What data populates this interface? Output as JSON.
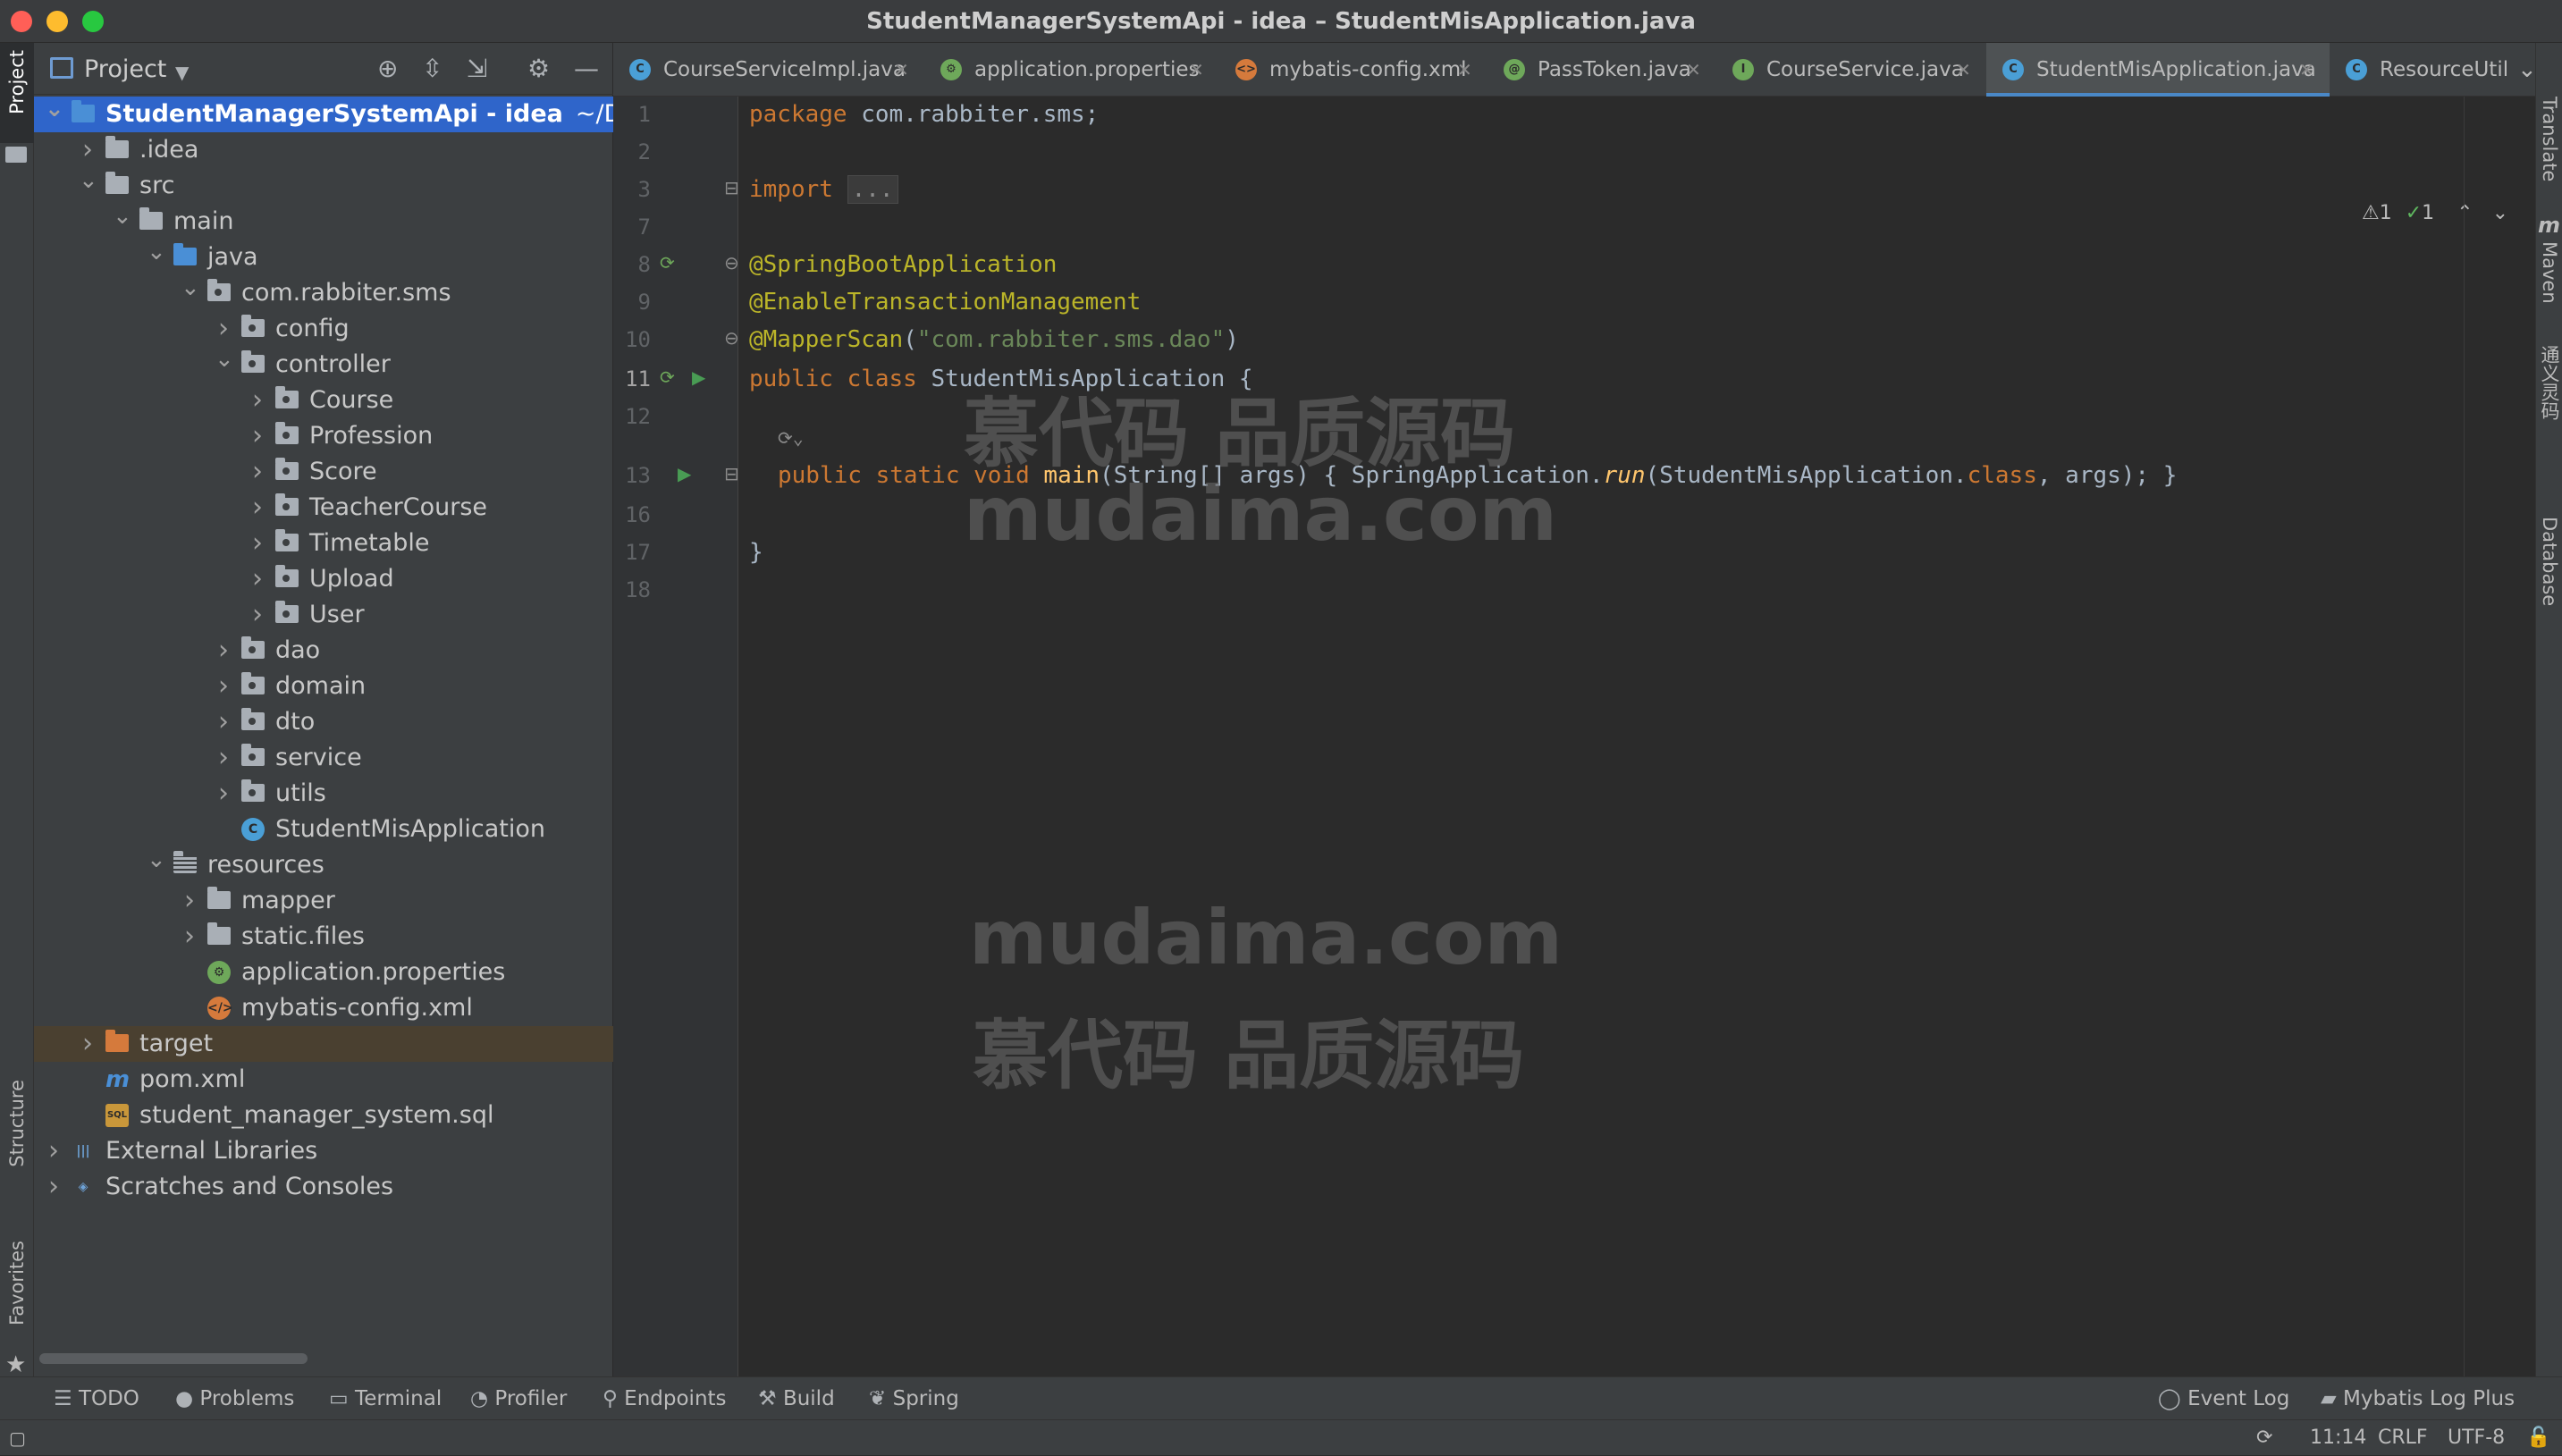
{
  "window": {
    "title": "StudentManagerSystemApi - idea – StudentMisApplication.java",
    "traffic": {
      "close": "#ff5f57",
      "minimize": "#febc2e",
      "zoom": "#28c840"
    }
  },
  "left_stripe": {
    "project": "Project",
    "structure": "Structure",
    "favorites": "Favorites"
  },
  "project_panel": {
    "header": "Project",
    "tree": [
      {
        "label": "StudentManagerSystemApi - idea",
        "suffix": "~/Downl",
        "depth": 0,
        "arrow": "down",
        "icon": "module",
        "selected": true
      },
      {
        "label": ".idea",
        "depth": 1,
        "arrow": "right",
        "icon": "folder"
      },
      {
        "label": "src",
        "depth": 1,
        "arrow": "down",
        "icon": "folder"
      },
      {
        "label": "main",
        "depth": 2,
        "arrow": "down",
        "icon": "folder"
      },
      {
        "label": "java",
        "depth": 3,
        "arrow": "down",
        "icon": "folder-blue"
      },
      {
        "label": "com.rabbiter.sms",
        "depth": 4,
        "arrow": "down",
        "icon": "package"
      },
      {
        "label": "config",
        "depth": 5,
        "arrow": "right",
        "icon": "package"
      },
      {
        "label": "controller",
        "depth": 5,
        "arrow": "down",
        "icon": "package"
      },
      {
        "label": "Course",
        "depth": 6,
        "arrow": "right",
        "icon": "package"
      },
      {
        "label": "Profession",
        "depth": 6,
        "arrow": "right",
        "icon": "package"
      },
      {
        "label": "Score",
        "depth": 6,
        "arrow": "right",
        "icon": "package"
      },
      {
        "label": "TeacherCourse",
        "depth": 6,
        "arrow": "right",
        "icon": "package"
      },
      {
        "label": "Timetable",
        "depth": 6,
        "arrow": "right",
        "icon": "package"
      },
      {
        "label": "Upload",
        "depth": 6,
        "arrow": "right",
        "icon": "package"
      },
      {
        "label": "User",
        "depth": 6,
        "arrow": "right",
        "icon": "package"
      },
      {
        "label": "dao",
        "depth": 5,
        "arrow": "right",
        "icon": "package"
      },
      {
        "label": "domain",
        "depth": 5,
        "arrow": "right",
        "icon": "package"
      },
      {
        "label": "dto",
        "depth": 5,
        "arrow": "right",
        "icon": "package"
      },
      {
        "label": "service",
        "depth": 5,
        "arrow": "right",
        "icon": "package"
      },
      {
        "label": "utils",
        "depth": 5,
        "arrow": "right",
        "icon": "package"
      },
      {
        "label": "StudentMisApplication",
        "depth": 5,
        "arrow": "none",
        "icon": "spring-class"
      },
      {
        "label": "resources",
        "depth": 3,
        "arrow": "down",
        "icon": "resources"
      },
      {
        "label": "mapper",
        "depth": 4,
        "arrow": "right",
        "icon": "folder"
      },
      {
        "label": "static.files",
        "depth": 4,
        "arrow": "right",
        "icon": "folder"
      },
      {
        "label": "application.properties",
        "depth": 4,
        "arrow": "none",
        "icon": "properties"
      },
      {
        "label": "mybatis-config.xml",
        "depth": 4,
        "arrow": "none",
        "icon": "xml"
      },
      {
        "label": "target",
        "depth": 1,
        "arrow": "right",
        "icon": "folder-orange",
        "highlight": true
      },
      {
        "label": "pom.xml",
        "depth": 1,
        "arrow": "none",
        "icon": "maven"
      },
      {
        "label": "student_manager_system.sql",
        "depth": 1,
        "arrow": "none",
        "icon": "sql"
      },
      {
        "label": "External Libraries",
        "depth": 0,
        "arrow": "right",
        "icon": "libraries"
      },
      {
        "label": "Scratches and Consoles",
        "depth": 0,
        "arrow": "right",
        "icon": "scratches"
      }
    ]
  },
  "tabs": [
    {
      "label": "CourseServiceImpl.java",
      "icon": "class-icon",
      "active": false
    },
    {
      "label": "application.properties",
      "icon": "properties-icon",
      "active": false
    },
    {
      "label": "mybatis-config.xml",
      "icon": "xml-icon",
      "active": false
    },
    {
      "label": "PassToken.java",
      "icon": "annotation-icon",
      "active": false
    },
    {
      "label": "CourseService.java",
      "icon": "interface-icon",
      "active": false
    },
    {
      "label": "StudentMisApplication.java",
      "icon": "spring-class-icon",
      "active": true
    },
    {
      "label": "ResourceUtil",
      "icon": "class-icon",
      "active": false
    }
  ],
  "editor": {
    "line_numbers": [
      "1",
      "2",
      "3",
      "7",
      "8",
      "9",
      "10",
      "11",
      "12",
      "13",
      "16",
      "17",
      "18"
    ],
    "current_line": "11",
    "inspections": {
      "warnings": "1",
      "ok": "1"
    },
    "lines": {
      "l1_kw": "package",
      "l1_rest": " com.rabbiter.sms;",
      "l3_kw": "import",
      "l3_fold": "...",
      "l8": "@SpringBootApplication",
      "l9": "@EnableTransactionManagement",
      "l10_ann": "@MapperScan",
      "l10_open": "(",
      "l10_str": "\"com.rabbiter.sms.dao\"",
      "l10_close": ")",
      "l11_kw": "public class",
      "l11_name": " StudentMisApplication {",
      "l13_kw": "public static void",
      "l13_fn": " main",
      "l13_args": "(String[] args) ",
      "l13_body_open": "{ SpringApplication.",
      "l13_run": "run",
      "l13_body_mid": "(StudentMisApplication.",
      "l13_class": "class",
      "l13_body_end": ", args); }",
      "l17": "}"
    },
    "watermarks": [
      "慕代码 品质源码",
      "mudaima.com",
      "mudaima.com",
      "慕代码 品质源码"
    ]
  },
  "right_stripe": {
    "translate": "Translate",
    "maven": "Maven",
    "chinese": "通义灵码",
    "database": "Database"
  },
  "bottom_tools": [
    "TODO",
    "Problems",
    "Terminal",
    "Profiler",
    "Endpoints",
    "Build",
    "Spring"
  ],
  "bottom_right_tools": [
    "Event Log",
    "Mybatis Log Plus"
  ],
  "status": {
    "position": "11:14",
    "line_sep": "CRLF",
    "encoding": "UTF-8"
  }
}
